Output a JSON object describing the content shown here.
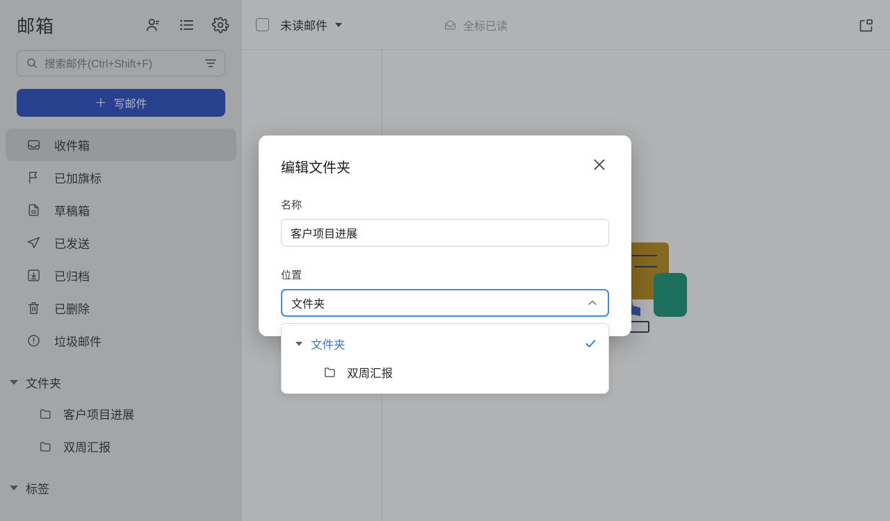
{
  "sidebar": {
    "title": "邮箱",
    "header_icons": [
      {
        "name": "contacts-icon"
      },
      {
        "name": "list-icon"
      },
      {
        "name": "gear-icon"
      }
    ],
    "search": {
      "placeholder": "搜索邮件(Ctrl+Shift+F)",
      "icon": "search-icon",
      "filter_icon": "filter-icon"
    },
    "compose": {
      "label": "写邮件",
      "plus": "＋",
      "color": "#1a43c4"
    },
    "nav_items": [
      {
        "label": "收件箱",
        "icon": "inbox-icon",
        "active": true
      },
      {
        "label": "已加旗标",
        "icon": "flag-icon",
        "active": false
      },
      {
        "label": "草稿箱",
        "icon": "draft-icon",
        "active": false
      },
      {
        "label": "已发送",
        "icon": "send-icon",
        "active": false
      },
      {
        "label": "已归档",
        "icon": "archive-icon",
        "active": false
      },
      {
        "label": "已删除",
        "icon": "trash-icon",
        "active": false
      },
      {
        "label": "垃圾邮件",
        "icon": "alert-icon",
        "active": false
      }
    ],
    "folders_group": {
      "label": "文件夹",
      "items": [
        {
          "label": "客户项目进展",
          "icon": "folder-icon"
        },
        {
          "label": "双周汇报",
          "icon": "folder-icon"
        }
      ]
    },
    "labels_group": {
      "label": "标签"
    }
  },
  "toolbar": {
    "select_all_checkbox": "select-all-checkbox",
    "filter_label": "未读邮件",
    "mark_all_read_label": "全标已读",
    "mark_all_read_icon": "envelope-open-icon",
    "panel_toggle_icon": "panel-layout-icon"
  },
  "reader": {
    "illustration": "empty-state-illustration",
    "illustration_colors": {
      "gold": "#b8860b",
      "teal": "#0a9172",
      "blue": "#2b4fbf",
      "navy": "#1c2b4a"
    }
  },
  "modal": {
    "title": "编辑文件夹",
    "close_icon": "close-icon",
    "name_field": {
      "label": "名称",
      "value": "客户项目进展"
    },
    "location_field": {
      "label": "位置",
      "value": "文件夹",
      "chevron_icon": "chevron-up-icon",
      "accent_color": "#4285f4"
    },
    "dropdown": {
      "root": {
        "label": "文件夹",
        "selected": true,
        "check_icon": "check-icon",
        "caret_icon": "caret-down-icon"
      },
      "children": [
        {
          "label": "双周汇报",
          "icon": "folder-icon"
        }
      ]
    }
  }
}
